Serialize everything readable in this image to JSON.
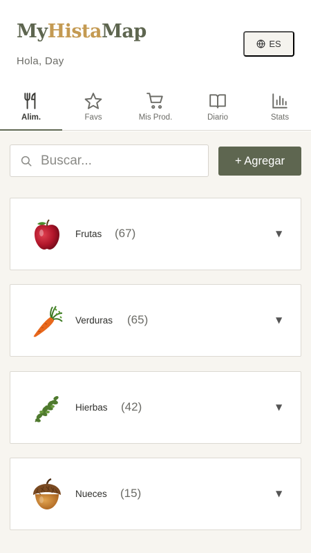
{
  "brand": {
    "part1": "My",
    "part2": "Hista",
    "part3": "Map"
  },
  "greeting": "Hola, Day",
  "language": {
    "label": "ES",
    "icon": "globe-icon"
  },
  "tabs": [
    {
      "label": "Alim.",
      "icon": "fork-knife-icon",
      "active": true
    },
    {
      "label": "Favs",
      "icon": "star-icon",
      "active": false
    },
    {
      "label": "Mis Prod.",
      "icon": "cart-icon",
      "active": false
    },
    {
      "label": "Diario",
      "icon": "book-icon",
      "active": false
    },
    {
      "label": "Stats",
      "icon": "bar-chart-icon",
      "active": false
    }
  ],
  "search": {
    "placeholder": "Buscar...",
    "value": ""
  },
  "add_button": "+ Agregar",
  "categories": [
    {
      "name": "Frutas",
      "count": "(67)",
      "icon": "apple-icon"
    },
    {
      "name": "Verduras",
      "count": "(65)",
      "icon": "carrot-icon"
    },
    {
      "name": "Hierbas",
      "count": "(42)",
      "icon": "herb-icon"
    },
    {
      "name": "Nueces",
      "count": "(15)",
      "icon": "acorn-icon"
    }
  ],
  "colors": {
    "accent": "#5e6650",
    "brand_gold": "#c49a52",
    "background": "#f7f5f0"
  }
}
